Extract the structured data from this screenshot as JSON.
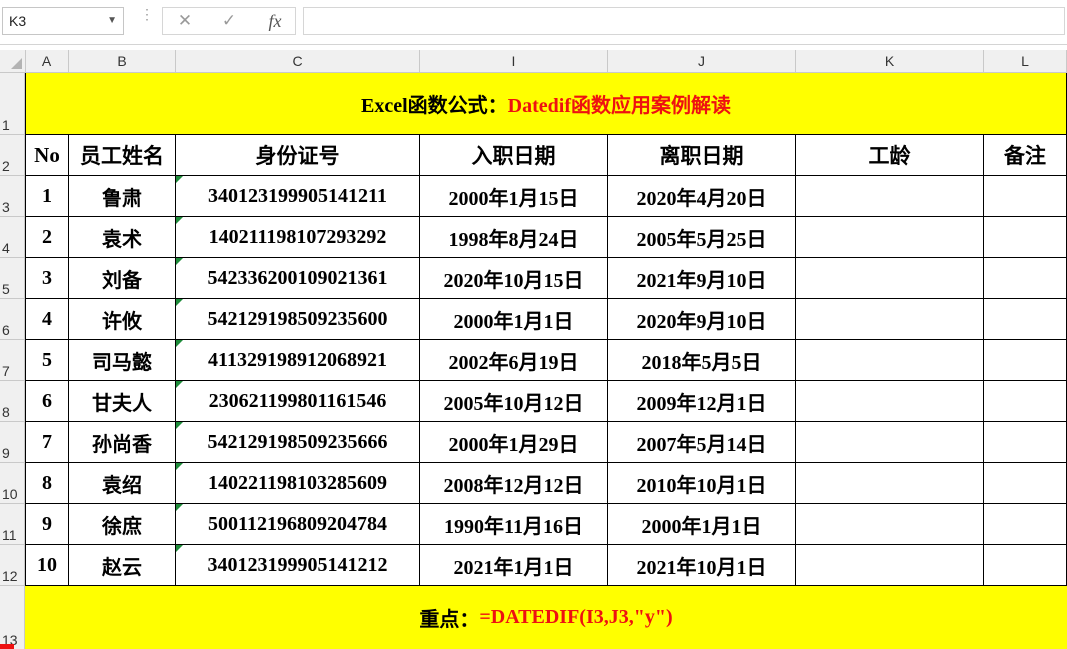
{
  "formula_bar": {
    "name_box": "K3",
    "cancel_icon": "✕",
    "enter_icon": "✓",
    "fx_label": "fx",
    "formula": ""
  },
  "columns": [
    "A",
    "B",
    "C",
    "I",
    "J",
    "K",
    "L"
  ],
  "rows": [
    "1",
    "2",
    "3",
    "4",
    "5",
    "6",
    "7",
    "8",
    "9",
    "10",
    "11",
    "12",
    "13"
  ],
  "title": {
    "part1": "Excel函数公式：",
    "part2": "Datedif函数应用案例解读"
  },
  "headers": [
    "No",
    "员工姓名",
    "身份证号",
    "入职日期",
    "离职日期",
    "工龄",
    "备注"
  ],
  "data": [
    [
      "1",
      "鲁肃",
      "340123199905141211",
      "2000年1月15日",
      "2020年4月20日",
      "",
      ""
    ],
    [
      "2",
      "袁术",
      "140211198107293292",
      "1998年8月24日",
      "2005年5月25日",
      "",
      ""
    ],
    [
      "3",
      "刘备",
      "542336200109021361",
      "2020年10月15日",
      "2021年9月10日",
      "",
      ""
    ],
    [
      "4",
      "许攸",
      "542129198509235600",
      "2000年1月1日",
      "2020年9月10日",
      "",
      ""
    ],
    [
      "5",
      "司马懿",
      "411329198912068921",
      "2002年6月19日",
      "2018年5月5日",
      "",
      ""
    ],
    [
      "6",
      "甘夫人",
      "230621199801161546",
      "2005年10月12日",
      "2009年12月1日",
      "",
      ""
    ],
    [
      "7",
      "孙尚香",
      "542129198509235666",
      "2000年1月29日",
      "2007年5月14日",
      "",
      ""
    ],
    [
      "8",
      "袁绍",
      "140221198103285609",
      "2008年12月12日",
      "2010年10月1日",
      "",
      ""
    ],
    [
      "9",
      "徐庶",
      "500112196809204784",
      "1990年11月16日",
      "2000年1月1日",
      "",
      ""
    ],
    [
      "10",
      "赵云",
      "340123199905141212",
      "2021年1月1日",
      "2021年10月1日",
      "",
      ""
    ]
  ],
  "note": {
    "part1": "重点：",
    "part2": "=DATEDIF(I3,J3,\"y\")"
  },
  "colors": {
    "highlight": "#ffff00",
    "accent_red": "#ee1111",
    "text_marker_green": "#1e8c3a"
  }
}
